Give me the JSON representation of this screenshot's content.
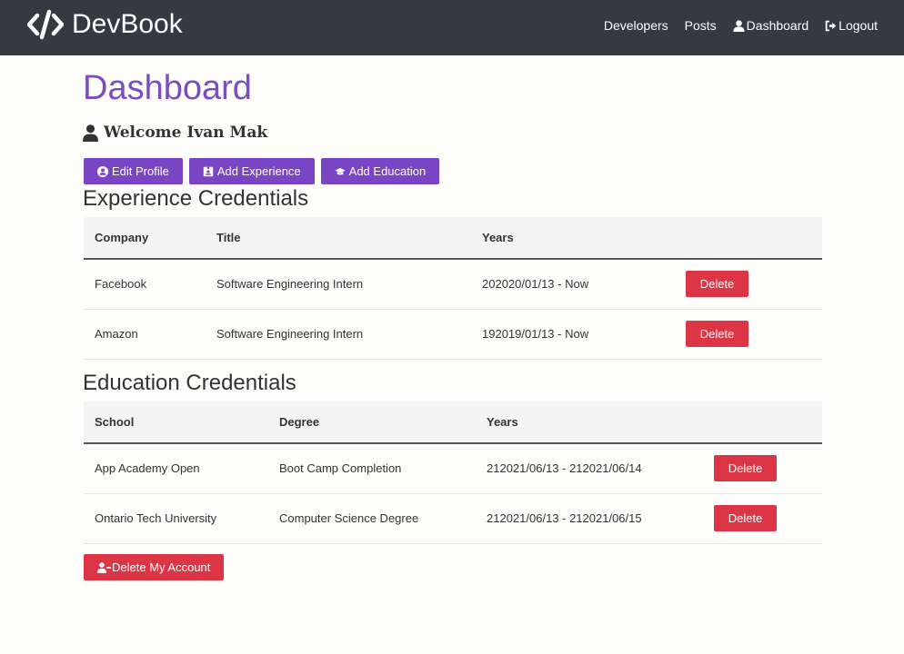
{
  "navbar": {
    "brand": "DevBook",
    "links": [
      {
        "label": "Developers",
        "icon": ""
      },
      {
        "label": "Posts",
        "icon": ""
      },
      {
        "label": "Dashboard",
        "icon": "user-icon"
      },
      {
        "label": "Logout",
        "icon": "sign-out-icon"
      }
    ]
  },
  "page": {
    "title": "Dashboard",
    "welcome": "Welcome Ivan Mak"
  },
  "actions": {
    "edit_profile": "Edit Profile",
    "add_experience": "Add Experience",
    "add_education": "Add Education"
  },
  "experience": {
    "title": "Experience Credentials",
    "headers": [
      "Company",
      "Title",
      "Years",
      ""
    ],
    "rows": [
      {
        "company": "Facebook",
        "title": "Software Engineering Intern",
        "years": "202020/01/13 - Now",
        "action": "Delete"
      },
      {
        "company": "Amazon",
        "title": "Software Engineering Intern",
        "years": "192019/01/13 - Now",
        "action": "Delete"
      }
    ]
  },
  "education": {
    "title": "Education Credentials",
    "headers": [
      "School",
      "Degree",
      "Years",
      ""
    ],
    "rows": [
      {
        "school": "App Academy Open",
        "degree": "Boot Camp Completion",
        "years": "212021/06/13 - 212021/06/14",
        "action": "Delete"
      },
      {
        "school": "Ontario Tech University",
        "degree": "Computer Science Degree",
        "years": "212021/06/13 - 212021/06/15",
        "action": "Delete"
      }
    ]
  },
  "delete_account": "Delete My Account",
  "colors": {
    "navbar": "#343a40",
    "primary": "#7a45c4",
    "danger": "#dc3545",
    "title": "#7b4cc2"
  }
}
